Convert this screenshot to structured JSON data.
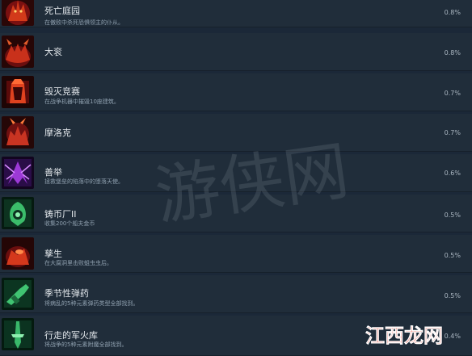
{
  "achievements": [
    {
      "title": "死亡庭园",
      "desc": "在傲败中杀死恐惧领主的仆从。",
      "pct": "0.8%",
      "icon": "demon-lord-icon",
      "colors": [
        "#7a1010",
        "#d23a1a",
        "#2a0707"
      ]
    },
    {
      "title": "大衮",
      "desc": "",
      "pct": "0.8%",
      "icon": "dagon-demon-icon",
      "colors": [
        "#6b0e0e",
        "#c9311b",
        "#260606"
      ]
    },
    {
      "title": "毁灭竞赛",
      "desc": "在战争机器中摧毁10座建筑。",
      "pct": "0.7%",
      "icon": "war-machine-icon",
      "colors": [
        "#5a0b0b",
        "#e0421f",
        "#1e0505"
      ]
    },
    {
      "title": "摩洛克",
      "desc": "",
      "pct": "0.7%",
      "icon": "moloch-icon",
      "colors": [
        "#6e1010",
        "#c83422",
        "#250707"
      ]
    },
    {
      "title": "善举",
      "desc": "拯救堡垒的陷落中的堕落天使。",
      "pct": "0.6%",
      "icon": "fallen-angel-icon",
      "colors": [
        "#2a0d48",
        "#9c39d6",
        "#12051f"
      ]
    },
    {
      "title": "铸币厂II",
      "desc": "收集200个船夫金币",
      "pct": "0.5%",
      "icon": "mint-coin-icon",
      "colors": [
        "#0d3320",
        "#3bbd6a",
        "#051a10"
      ]
    },
    {
      "title": "孳生",
      "desc": "在大腐洞里击败蛆虫虫后。",
      "pct": "0.5%",
      "icon": "maggot-queen-icon",
      "colors": [
        "#6a0e0e",
        "#d4381c",
        "#240606"
      ]
    },
    {
      "title": "季节性弹药",
      "desc": "将病乱的5种元素弹药类型全部找到。",
      "pct": "0.5%",
      "icon": "ammo-gun-icon",
      "colors": [
        "#0c3521",
        "#40c472",
        "#041a0f"
      ]
    },
    {
      "title": "行走的军火库",
      "desc": "将战争的5种元素附魔全部找到。",
      "pct": "0.4%",
      "icon": "arsenal-weapon-icon",
      "colors": [
        "#0b3320",
        "#39b86a",
        "#041a0f"
      ]
    }
  ],
  "watermark": "游侠网",
  "corner_brand": "江西龙网"
}
